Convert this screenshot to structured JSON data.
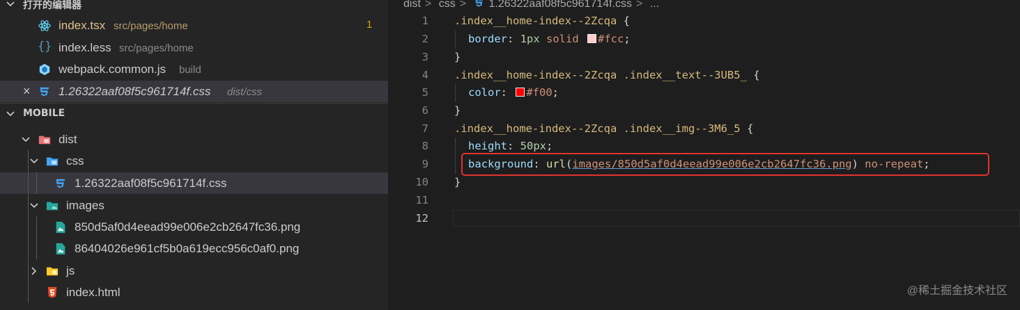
{
  "sidebar": {
    "open_editors": {
      "title": "打开的编辑器",
      "items": [
        {
          "name": "index.tsx",
          "desc": "src/pages/home",
          "badge": "1",
          "icon": "react-icon"
        },
        {
          "name": "index.less",
          "desc": "src/pages/home",
          "icon": "braces-icon"
        },
        {
          "name": "webpack.common.js",
          "desc": "build",
          "icon": "cube-icon"
        },
        {
          "name": "1.26322aaf08f5c961714f.css",
          "desc": "dist/css",
          "icon": "css-icon",
          "close": "×"
        }
      ]
    },
    "explorer": {
      "title": "MOBILE",
      "tree": [
        {
          "name": "dist",
          "type": "folder",
          "icon": "folder-dist-icon"
        },
        {
          "name": "css",
          "type": "folder",
          "icon": "folder-css-icon"
        },
        {
          "name": "1.26322aaf08f5c961714f.css",
          "type": "file",
          "icon": "css-icon"
        },
        {
          "name": "images",
          "type": "folder",
          "icon": "folder-images-icon"
        },
        {
          "name": "850d5af0d4eead99e006e2cb2647fc36.png",
          "type": "file",
          "icon": "image-icon"
        },
        {
          "name": "86404026e961cf5b0a619ecc956c0af0.png",
          "type": "file",
          "icon": "image-icon"
        },
        {
          "name": "js",
          "type": "folder",
          "icon": "folder-js-icon"
        },
        {
          "name": "index.html",
          "type": "file",
          "icon": "html-icon"
        }
      ]
    }
  },
  "editor": {
    "breadcrumb": [
      "dist",
      "css",
      "1.26322aaf08f5c961714f.css",
      "..."
    ],
    "line_numbers": [
      "1",
      "2",
      "3",
      "4",
      "5",
      "6",
      "7",
      "8",
      "9",
      "10",
      "11",
      "12"
    ],
    "lines": {
      "l1_sel": ".index__home-index--2Zcqa",
      "l1_brace": " {",
      "l2_prop": "border",
      "l2_colon": ": ",
      "l2_num": "1px",
      "l2_kw": " solid ",
      "l2_color": "#fcc",
      "l2_end": ";",
      "l3": "}",
      "l4_sel": ".index__home-index--2Zcqa .index__text--3UB5_",
      "l4_brace": " {",
      "l5_prop": "color",
      "l5_colon": ": ",
      "l5_color": "#f00",
      "l5_end": ";",
      "l6": "}",
      "l7_sel": ".index__home-index--2Zcqa .index__img--3M6_5",
      "l7_brace": " {",
      "l8_prop": "height",
      "l8_colon": ": ",
      "l8_num": "50px",
      "l8_end": ";",
      "l9_prop": "background",
      "l9_colon": ": ",
      "l9_fn": "url",
      "l9_open": "(",
      "l9_link": "images/850d5af0d4eead99e006e2cb2647fc36.png",
      "l9_close": ")",
      "l9_kw": " no-repeat",
      "l9_end": ";",
      "l10": "}"
    }
  },
  "watermark": "@稀土掘金技术社区",
  "colors": {
    "swatch_fcc": "#ffcccc",
    "swatch_f00": "#ff0000",
    "highlight": "#e0332f"
  }
}
